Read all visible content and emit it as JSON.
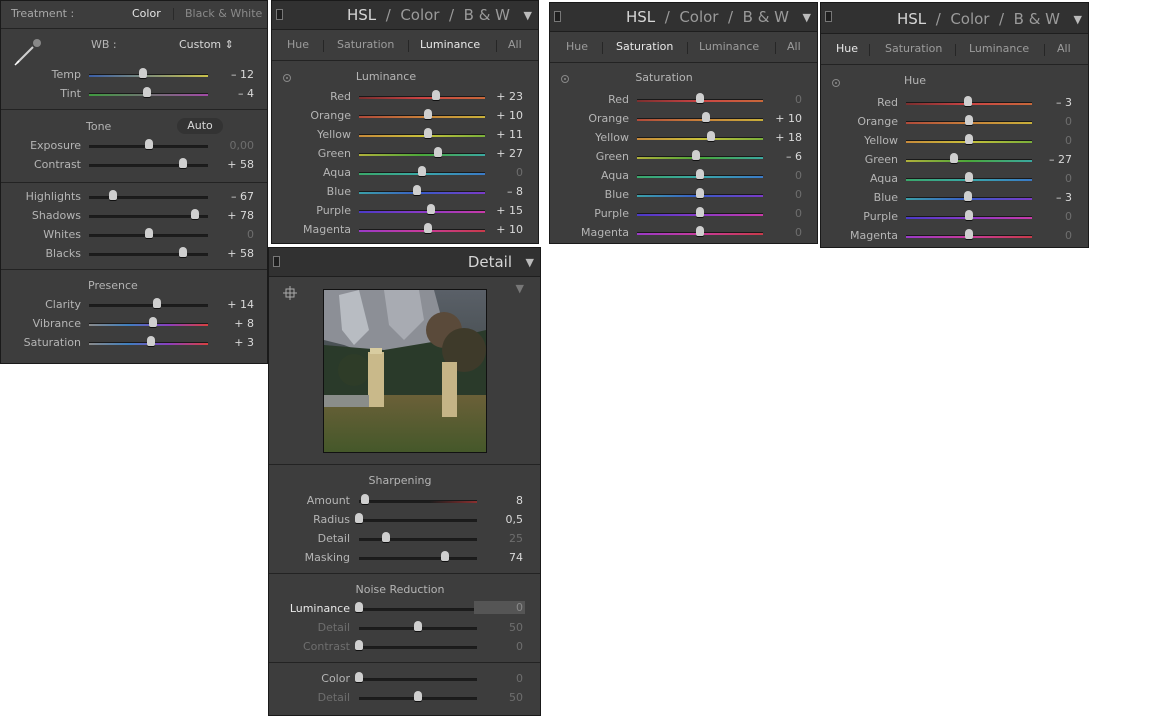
{
  "basic": {
    "treatment_label": "Treatment :",
    "treatment_color": "Color",
    "treatment_bw": "Black & White",
    "wb_label": "WB :",
    "wb_value": "Custom",
    "tone_label": "Tone",
    "auto_label": "Auto",
    "presence_label": "Presence",
    "sliders": [
      {
        "name": "Temp",
        "value": "– 12",
        "pos": 0.45,
        "grad": "linear-gradient(90deg,#3b5fa8,#c9c14a)"
      },
      {
        "name": "Tint",
        "value": "– 4",
        "pos": 0.49,
        "grad": "linear-gradient(90deg,#3f9a3f,#a24aa6)"
      },
      {
        "name": "Exposure",
        "value": "0,00",
        "pos": 0.5,
        "grad": "#1c1c1c",
        "dim": true
      },
      {
        "name": "Contrast",
        "value": "+ 58",
        "pos": 0.79,
        "grad": "#1c1c1c"
      },
      {
        "name": "Highlights",
        "value": "– 67",
        "pos": 0.2,
        "grad": "#1c1c1c"
      },
      {
        "name": "Shadows",
        "value": "+ 78",
        "pos": 0.89,
        "grad": "#1c1c1c"
      },
      {
        "name": "Whites",
        "value": "0",
        "pos": 0.5,
        "grad": "#1c1c1c",
        "dim": true
      },
      {
        "name": "Blacks",
        "value": "+ 58",
        "pos": 0.79,
        "grad": "#1c1c1c"
      },
      {
        "name": "Clarity",
        "value": "+ 14",
        "pos": 0.57,
        "grad": "#1c1c1c"
      },
      {
        "name": "Vibrance",
        "value": "+ 8",
        "pos": 0.54,
        "grad": "linear-gradient(90deg,#8a8a8a,#3f7fbf,#8a3fbf,#d84040)"
      },
      {
        "name": "Saturation",
        "value": "+ 3",
        "pos": 0.52,
        "grad": "linear-gradient(90deg,#8a8a8a,#3f7fbf,#8a3fbf,#d84040)"
      }
    ]
  },
  "hsl_tabs": {
    "title_hsl": "HSL",
    "title_color": "Color",
    "title_bw": "B & W",
    "sep": "/",
    "hue": "Hue",
    "saturation": "Saturation",
    "luminance": "Luminance",
    "all": "All"
  },
  "hsl_lum": {
    "heading": "Luminance",
    "rows": [
      {
        "name": "Red",
        "value": "+ 23",
        "pos": 0.61
      },
      {
        "name": "Orange",
        "value": "+ 10",
        "pos": 0.55
      },
      {
        "name": "Yellow",
        "value": "+ 11",
        "pos": 0.55
      },
      {
        "name": "Green",
        "value": "+ 27",
        "pos": 0.63
      },
      {
        "name": "Aqua",
        "value": "0",
        "pos": 0.5,
        "dim": true
      },
      {
        "name": "Blue",
        "value": "– 8",
        "pos": 0.46
      },
      {
        "name": "Purple",
        "value": "+ 15",
        "pos": 0.57
      },
      {
        "name": "Magenta",
        "value": "+ 10",
        "pos": 0.55
      }
    ]
  },
  "hsl_sat": {
    "heading": "Saturation",
    "rows": [
      {
        "name": "Red",
        "value": "0",
        "pos": 0.5,
        "dim": true
      },
      {
        "name": "Orange",
        "value": "+ 10",
        "pos": 0.55
      },
      {
        "name": "Yellow",
        "value": "+ 18",
        "pos": 0.59
      },
      {
        "name": "Green",
        "value": "– 6",
        "pos": 0.47
      },
      {
        "name": "Aqua",
        "value": "0",
        "pos": 0.5,
        "dim": true
      },
      {
        "name": "Blue",
        "value": "0",
        "pos": 0.5,
        "dim": true
      },
      {
        "name": "Purple",
        "value": "0",
        "pos": 0.5,
        "dim": true
      },
      {
        "name": "Magenta",
        "value": "0",
        "pos": 0.5,
        "dim": true
      }
    ]
  },
  "hsl_hue": {
    "heading": "Hue",
    "rows": [
      {
        "name": "Red",
        "value": "– 3",
        "pos": 0.49
      },
      {
        "name": "Orange",
        "value": "0",
        "pos": 0.5,
        "dim": true
      },
      {
        "name": "Yellow",
        "value": "0",
        "pos": 0.5,
        "dim": true
      },
      {
        "name": "Green",
        "value": "– 27",
        "pos": 0.38
      },
      {
        "name": "Aqua",
        "value": "0",
        "pos": 0.5,
        "dim": true
      },
      {
        "name": "Blue",
        "value": "– 3",
        "pos": 0.49
      },
      {
        "name": "Purple",
        "value": "0",
        "pos": 0.5,
        "dim": true
      },
      {
        "name": "Magenta",
        "value": "0",
        "pos": 0.5,
        "dim": true
      }
    ]
  },
  "detail": {
    "title": "Detail",
    "sharpening_heading": "Sharpening",
    "noise_heading": "Noise Reduction",
    "sharpening": [
      {
        "name": "Amount",
        "value": "8",
        "pos": 0.05,
        "grad": "linear-gradient(90deg,#1c1c1c,#1c1c1c 60%,#8a3030)"
      },
      {
        "name": "Radius",
        "value": "0,5",
        "pos": 0.0,
        "grad": "#1c1c1c"
      },
      {
        "name": "Detail",
        "value": "25",
        "pos": 0.23,
        "grad": "#1c1c1c",
        "dim": true
      },
      {
        "name": "Masking",
        "value": "74",
        "pos": 0.73,
        "grad": "#1c1c1c"
      }
    ],
    "noise": [
      {
        "name": "Luminance",
        "value": "0",
        "pos": 0.0,
        "grad": "#1c1c1c",
        "hl": true
      },
      {
        "name": "Detail",
        "value": "50",
        "pos": 0.5,
        "grad": "#1c1c1c",
        "dim": true,
        "dimlbl": true
      },
      {
        "name": "Contrast",
        "value": "0",
        "pos": 0.0,
        "grad": "#1c1c1c",
        "dim": true,
        "dimlbl": true
      }
    ],
    "color": [
      {
        "name": "Color",
        "value": "0",
        "pos": 0.0,
        "grad": "#1c1c1c",
        "dim": true
      },
      {
        "name": "Detail",
        "value": "50",
        "pos": 0.5,
        "grad": "#1c1c1c",
        "dim": true,
        "dimlbl": true
      }
    ]
  },
  "hsl_colors": {
    "Red": "linear-gradient(90deg,#7a2f2f,#c44,#c8683a)",
    "Orange": "linear-gradient(90deg,#b04a3a,#c8803a,#c8b03a)",
    "Yellow": "linear-gradient(90deg,#c88a3a,#c8c03a,#7ab03a)",
    "Green": "linear-gradient(90deg,#b0b03a,#4aa83a,#3aa8a0)",
    "Aqua": "linear-gradient(90deg,#3aa86a,#3aa8a8,#3a7ac8)",
    "Blue": "linear-gradient(90deg,#3aa0a8,#3a5ac8,#7a3ac8)",
    "Purple": "linear-gradient(90deg,#4a3ac8,#8a3ac8,#c83aa8)",
    "Magenta": "linear-gradient(90deg,#9a3ac8,#c83a9a,#c83a4a)"
  }
}
